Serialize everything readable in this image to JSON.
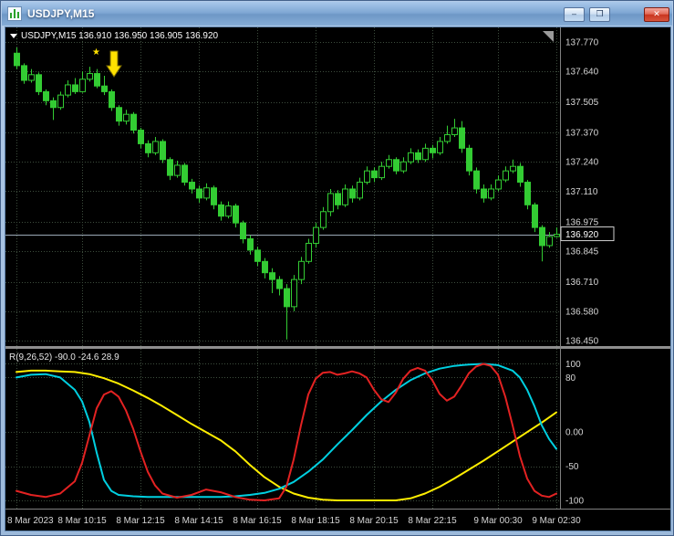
{
  "window": {
    "title": "USDJPY,M15",
    "buttons": [
      {
        "name": "minimize",
        "glyph": "–"
      },
      {
        "name": "maximize",
        "glyph": "❐"
      },
      {
        "name": "close",
        "glyph": "✕"
      }
    ]
  },
  "colors": {
    "background": "#000000",
    "candle": "#33cc33",
    "grid": "#3d4d3d",
    "axis_text": "#d6d6d6",
    "bid_line": "#9aa8b5",
    "marker": "#ffe100",
    "separator": "#8f8f8f"
  },
  "chart_data": {
    "type": "candlestick",
    "symbol": "USDJPY",
    "timeframe": "M15",
    "info_text": "USDJPY,M15 136.910 136.950 136.905 136.920",
    "current_ohlc": {
      "open": 136.91,
      "high": 136.95,
      "low": 136.905,
      "close": 136.92
    },
    "bid": 136.92,
    "price_axis": [
      137.77,
      137.64,
      137.505,
      137.37,
      137.24,
      137.11,
      136.975,
      136.845,
      136.71,
      136.58,
      136.45
    ],
    "main": {
      "x0": 12,
      "x_step": 8,
      "price_top_edge": 137.834,
      "price_bottom_edge": 136.426
    },
    "time_ticks": [
      {
        "i": 0,
        "label": "8 Mar 2023"
      },
      {
        "i": 9,
        "label": "8 Mar 10:15"
      },
      {
        "i": 17,
        "label": "8 Mar 12:15"
      },
      {
        "i": 25,
        "label": "8 Mar 14:15"
      },
      {
        "i": 33,
        "label": "8 Mar 16:15"
      },
      {
        "i": 41,
        "label": "8 Mar 18:15"
      },
      {
        "i": 49,
        "label": "8 Mar 20:15"
      },
      {
        "i": 57,
        "label": "8 Mar 22:15"
      },
      {
        "i": 66,
        "label": "9 Mar 00:30"
      },
      {
        "i": 74,
        "label": "9 Mar 02:30"
      }
    ],
    "candles": [
      [
        137.72,
        137.745,
        137.65,
        137.665
      ],
      [
        137.665,
        137.675,
        137.585,
        137.6
      ],
      [
        137.6,
        137.65,
        137.59,
        137.625
      ],
      [
        137.625,
        137.635,
        137.535,
        137.55
      ],
      [
        137.55,
        137.56,
        137.49,
        137.51
      ],
      [
        137.51,
        137.525,
        137.425,
        137.48
      ],
      [
        137.48,
        137.55,
        137.47,
        137.535
      ],
      [
        137.535,
        137.6,
        137.525,
        137.58
      ],
      [
        137.58,
        137.61,
        137.54,
        137.55
      ],
      [
        137.55,
        137.64,
        137.545,
        137.605
      ],
      [
        137.605,
        137.66,
        137.595,
        137.63
      ],
      [
        137.63,
        137.65,
        137.565,
        137.575
      ],
      [
        137.575,
        137.62,
        137.535,
        137.55
      ],
      [
        137.55,
        137.56,
        137.465,
        137.48
      ],
      [
        137.48,
        137.49,
        137.4,
        137.42
      ],
      [
        137.42,
        137.47,
        137.405,
        137.45
      ],
      [
        137.45,
        137.46,
        137.365,
        137.38
      ],
      [
        137.38,
        137.39,
        137.3,
        137.32
      ],
      [
        137.32,
        137.335,
        137.26,
        137.28
      ],
      [
        137.28,
        137.35,
        137.27,
        137.33
      ],
      [
        137.33,
        137.34,
        137.235,
        137.25
      ],
      [
        137.25,
        137.26,
        137.16,
        137.18
      ],
      [
        137.18,
        137.245,
        137.17,
        137.225
      ],
      [
        137.225,
        137.235,
        137.135,
        137.15
      ],
      [
        137.15,
        137.165,
        137.1,
        137.12
      ],
      [
        137.12,
        137.135,
        137.06,
        137.08
      ],
      [
        137.08,
        137.145,
        137.07,
        137.125
      ],
      [
        137.125,
        137.135,
        137.03,
        137.05
      ],
      [
        137.05,
        137.065,
        136.98,
        137.0
      ],
      [
        137.0,
        137.065,
        136.99,
        137.045
      ],
      [
        137.045,
        137.055,
        136.95,
        136.97
      ],
      [
        136.97,
        136.98,
        136.88,
        136.9
      ],
      [
        136.9,
        136.915,
        136.83,
        136.85
      ],
      [
        136.85,
        136.865,
        136.78,
        136.8
      ],
      [
        136.8,
        136.815,
        136.725,
        136.75
      ],
      [
        136.75,
        136.77,
        136.66,
        136.72
      ],
      [
        136.72,
        136.735,
        136.65,
        136.68
      ],
      [
        136.68,
        136.7,
        136.455,
        136.6
      ],
      [
        136.6,
        136.74,
        136.58,
        136.72
      ],
      [
        136.72,
        136.82,
        136.7,
        136.8
      ],
      [
        136.8,
        136.9,
        136.79,
        136.88
      ],
      [
        136.88,
        136.97,
        136.86,
        136.95
      ],
      [
        136.95,
        137.04,
        136.94,
        137.02
      ],
      [
        137.02,
        137.12,
        137.0,
        137.1
      ],
      [
        137.1,
        137.115,
        137.03,
        137.05
      ],
      [
        137.05,
        137.14,
        137.04,
        137.12
      ],
      [
        137.12,
        137.135,
        137.06,
        137.08
      ],
      [
        137.08,
        137.17,
        137.07,
        137.15
      ],
      [
        137.15,
        137.22,
        137.14,
        137.2
      ],
      [
        137.2,
        137.215,
        137.15,
        137.17
      ],
      [
        137.17,
        137.24,
        137.16,
        137.22
      ],
      [
        137.22,
        137.27,
        137.21,
        137.25
      ],
      [
        137.25,
        137.26,
        137.185,
        137.2
      ],
      [
        137.2,
        137.26,
        137.19,
        137.24
      ],
      [
        137.24,
        137.3,
        137.23,
        137.28
      ],
      [
        137.28,
        137.295,
        137.235,
        137.25
      ],
      [
        137.25,
        137.32,
        137.24,
        137.3
      ],
      [
        137.3,
        137.315,
        137.255,
        137.28
      ],
      [
        137.28,
        137.35,
        137.27,
        137.33
      ],
      [
        137.33,
        137.4,
        137.32,
        137.36
      ],
      [
        137.36,
        137.43,
        137.35,
        137.39
      ],
      [
        137.39,
        137.42,
        137.28,
        137.3
      ],
      [
        137.3,
        137.315,
        137.18,
        137.2
      ],
      [
        137.2,
        137.215,
        137.1,
        137.12
      ],
      [
        137.12,
        137.14,
        137.06,
        137.08
      ],
      [
        137.08,
        137.14,
        137.07,
        137.12
      ],
      [
        137.12,
        137.18,
        137.11,
        137.16
      ],
      [
        137.16,
        137.22,
        137.15,
        137.2
      ],
      [
        137.2,
        137.25,
        137.19,
        137.22
      ],
      [
        137.22,
        137.235,
        137.13,
        137.15
      ],
      [
        137.15,
        137.16,
        137.03,
        137.05
      ],
      [
        137.05,
        137.06,
        136.93,
        136.95
      ],
      [
        136.95,
        136.96,
        136.8,
        136.87
      ],
      [
        136.87,
        136.93,
        136.86,
        136.91
      ],
      [
        136.91,
        136.95,
        136.905,
        136.92
      ]
    ],
    "indicator": {
      "name": "R(9,26,52)",
      "info_text": "R(9,26,52) -90.0 -24.6 28.9",
      "current_values": [
        -90.0,
        -24.6,
        28.9
      ],
      "top_edge": 122,
      "bottom_edge": -112,
      "levels": [
        {
          "v": 100,
          "label": "100"
        },
        {
          "v": 80,
          "label": "80"
        },
        {
          "v": 0,
          "label": "0.00"
        },
        {
          "v": -50,
          "label": "-50"
        },
        {
          "v": -100,
          "label": "-100"
        }
      ],
      "series": [
        {
          "name": "yellow",
          "color": "#ffee00",
          "points": [
            [
              0,
              88
            ],
            [
              2,
              90
            ],
            [
              4,
              90
            ],
            [
              6,
              89
            ],
            [
              8,
              88
            ],
            [
              10,
              85
            ],
            [
              12,
              79
            ],
            [
              14,
              71
            ],
            [
              16,
              61
            ],
            [
              18,
              50
            ],
            [
              20,
              38
            ],
            [
              22,
              25
            ],
            [
              24,
              12
            ],
            [
              26,
              0
            ],
            [
              28,
              -12
            ],
            [
              30,
              -28
            ],
            [
              32,
              -48
            ],
            [
              34,
              -66
            ],
            [
              36,
              -80
            ],
            [
              38,
              -90
            ],
            [
              40,
              -96
            ],
            [
              42,
              -99
            ],
            [
              44,
              -100
            ],
            [
              46,
              -100
            ],
            [
              48,
              -100
            ],
            [
              50,
              -100
            ],
            [
              52,
              -100
            ],
            [
              54,
              -97
            ],
            [
              56,
              -90
            ],
            [
              58,
              -80
            ],
            [
              60,
              -68
            ],
            [
              62,
              -55
            ],
            [
              64,
              -42
            ],
            [
              66,
              -28
            ],
            [
              68,
              -14
            ],
            [
              70,
              0
            ],
            [
              72,
              14
            ],
            [
              74,
              28.9
            ]
          ]
        },
        {
          "name": "cyan",
          "color": "#00cfe0",
          "points": [
            [
              0,
              80
            ],
            [
              2,
              84
            ],
            [
              4,
              85
            ],
            [
              6,
              80
            ],
            [
              8,
              62
            ],
            [
              9,
              45
            ],
            [
              10,
              15
            ],
            [
              11,
              -30
            ],
            [
              12,
              -70
            ],
            [
              13,
              -86
            ],
            [
              14,
              -92
            ],
            [
              16,
              -94
            ],
            [
              18,
              -95
            ],
            [
              20,
              -95
            ],
            [
              22,
              -95
            ],
            [
              24,
              -95
            ],
            [
              26,
              -95
            ],
            [
              28,
              -95
            ],
            [
              30,
              -94
            ],
            [
              32,
              -92
            ],
            [
              34,
              -89
            ],
            [
              36,
              -83
            ],
            [
              38,
              -73
            ],
            [
              40,
              -58
            ],
            [
              42,
              -40
            ],
            [
              44,
              -18
            ],
            [
              46,
              3
            ],
            [
              48,
              25
            ],
            [
              50,
              45
            ],
            [
              52,
              62
            ],
            [
              54,
              76
            ],
            [
              56,
              86
            ],
            [
              58,
              93
            ],
            [
              60,
              97
            ],
            [
              62,
              99
            ],
            [
              64,
              100
            ],
            [
              66,
              98
            ],
            [
              68,
              90
            ],
            [
              69,
              80
            ],
            [
              70,
              62
            ],
            [
              71,
              38
            ],
            [
              72,
              10
            ],
            [
              73,
              -10
            ],
            [
              74,
              -24.6
            ]
          ]
        },
        {
          "name": "red",
          "color": "#e32222",
          "points": [
            [
              0,
              -86
            ],
            [
              2,
              -92
            ],
            [
              4,
              -95
            ],
            [
              6,
              -90
            ],
            [
              8,
              -72
            ],
            [
              9,
              -45
            ],
            [
              10,
              -5
            ],
            [
              11,
              35
            ],
            [
              12,
              55
            ],
            [
              13,
              60
            ],
            [
              14,
              52
            ],
            [
              15,
              32
            ],
            [
              16,
              5
            ],
            [
              17,
              -28
            ],
            [
              18,
              -58
            ],
            [
              19,
              -78
            ],
            [
              20,
              -90
            ],
            [
              22,
              -96
            ],
            [
              24,
              -92
            ],
            [
              26,
              -84
            ],
            [
              28,
              -88
            ],
            [
              30,
              -95
            ],
            [
              32,
              -99
            ],
            [
              34,
              -100
            ],
            [
              36,
              -97
            ],
            [
              37,
              -80
            ],
            [
              38,
              -40
            ],
            [
              39,
              10
            ],
            [
              40,
              55
            ],
            [
              41,
              78
            ],
            [
              42,
              87
            ],
            [
              43,
              88
            ],
            [
              44,
              84
            ],
            [
              45,
              86
            ],
            [
              46,
              89
            ],
            [
              47,
              86
            ],
            [
              48,
              80
            ],
            [
              49,
              62
            ],
            [
              50,
              48
            ],
            [
              51,
              44
            ],
            [
              52,
              58
            ],
            [
              53,
              78
            ],
            [
              54,
              90
            ],
            [
              55,
              94
            ],
            [
              56,
              90
            ],
            [
              57,
              76
            ],
            [
              58,
              56
            ],
            [
              59,
              46
            ],
            [
              60,
              52
            ],
            [
              61,
              68
            ],
            [
              62,
              86
            ],
            [
              63,
              96
            ],
            [
              64,
              100
            ],
            [
              65,
              97
            ],
            [
              66,
              84
            ],
            [
              67,
              52
            ],
            [
              68,
              10
            ],
            [
              69,
              -35
            ],
            [
              70,
              -68
            ],
            [
              71,
              -86
            ],
            [
              72,
              -93
            ],
            [
              73,
              -95
            ],
            [
              74,
              -90
            ]
          ]
        }
      ]
    }
  }
}
